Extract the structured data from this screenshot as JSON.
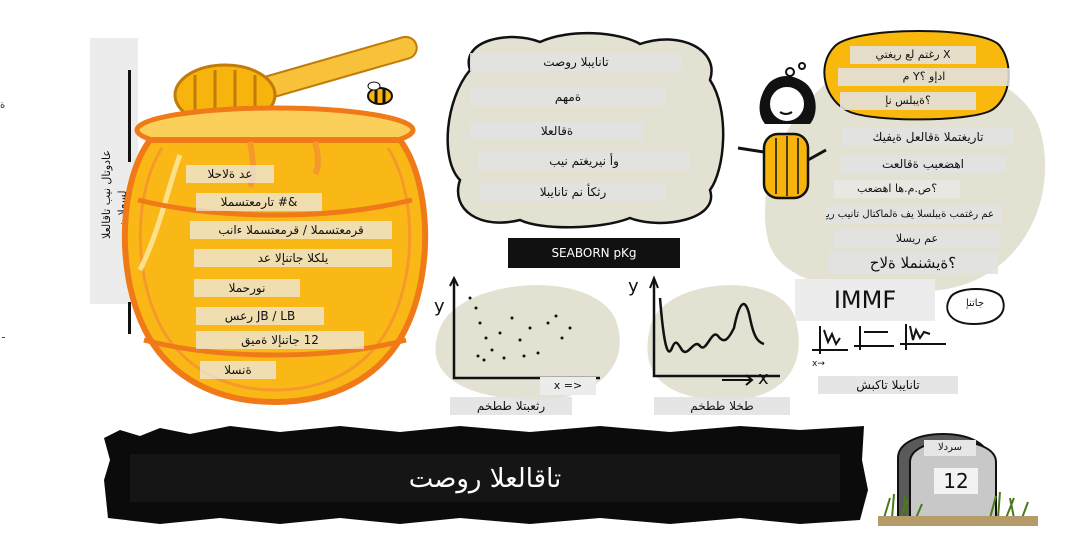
{
  "side_vertical": {
    "line1": "عادوتال نيب تاقالعلا",
    "line2": "لسعلا ن-"
  },
  "edge_marks": {
    "top": "ة",
    "bottom": "ـ"
  },
  "honey_pot_labels": [
    "عد ةلاحلا",
    "&# تارمعتسملا",
    "قرمعتسملا / قرمعتسملا ءانب",
    "يلكلا جاتنإلا عد",
    "نورحملا",
    "JB / LB رعس",
    "12 جاتنإلا ةميق",
    "ةنسلا"
  ],
  "cloud_labels": [
    "تانايبلا روصت",
    "ةمهم",
    "ةقالعلا",
    "وأ نيريغتم نيب",
    "رثكأ نم تانايبلا"
  ],
  "seaborn_label": "SEABORN pKg",
  "bubble_labels": [
    "X رغتم لع ريغتي",
    "ادإو ؟Y م",
    "؟ةيبلس نإ"
  ],
  "right_labels": [
    "تاريغتملا ةقالعل ةيفيك",
    "اهضعبب ةقالعت",
    "؟ص.م.ها اهضعب",
    "عم رغتمب ةيبلسلا يف ةلماكتال تانيب ريغ",
    "عم ريسلا",
    "؟ةيشنملا ةلاح"
  ],
  "immf_label": "IMMF",
  "small_bubble": "جاتنإ",
  "scatter": {
    "y_label": "y",
    "x_arrow": "x =>",
    "caption": "رثعبتلا ططخم"
  },
  "line_plot": {
    "y_label": "y",
    "x_label": "x",
    "caption": "طخلا ططخم"
  },
  "facets_caption": "تانايبلا تاكبش",
  "banner_title": "تاقالعلا روصت",
  "tombstone": {
    "label": "سردلا",
    "number": "12"
  },
  "colors": {
    "honey": "#f7b40d",
    "honey_light": "#fbd05a",
    "pot_outline": "#f07a18",
    "blob": "#e3e1d2",
    "banner": "#0b0b0b",
    "bubble_yellow": "#f8b80c"
  },
  "icons": [
    "honey-dipper-icon",
    "bee-icon",
    "person-icon",
    "tombstone-icon",
    "grass-icon"
  ]
}
